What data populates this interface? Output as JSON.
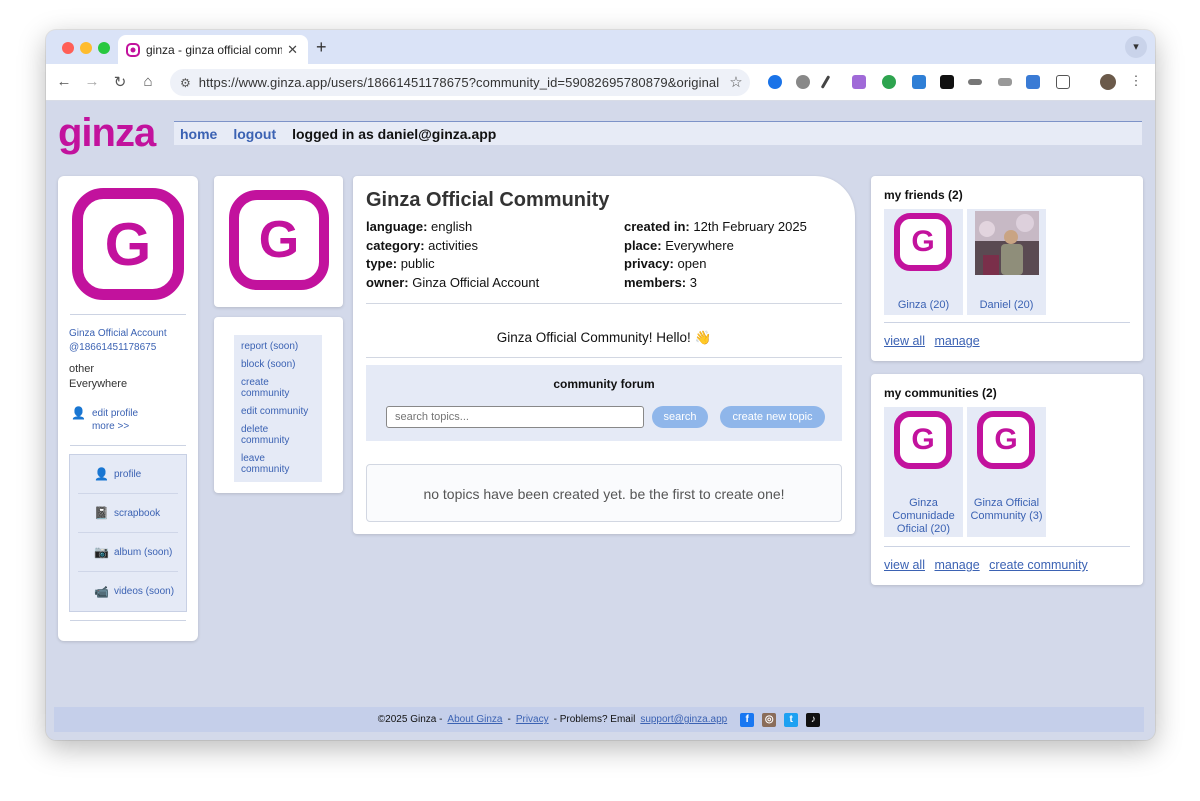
{
  "browser": {
    "tab_title": "ginza - ginza official community",
    "url": "https://www.ginza.app/users/18661451178675?community_id=59082695780879&original_pro...",
    "new_tab": "+",
    "close": "✕"
  },
  "header": {
    "logo": "ginza",
    "nav_home": "home",
    "nav_logout": "logout",
    "logged_in": "logged in as daniel@ginza.app"
  },
  "profile": {
    "name": "Ginza Official Account",
    "handle": "@18661451178675",
    "gender": "other",
    "location": "Everywhere",
    "edit_profile": "edit profile",
    "more": "more >>",
    "menu": [
      {
        "label": "profile",
        "icon": "person-icon"
      },
      {
        "label": "scrapbook",
        "icon": "notebook-icon"
      },
      {
        "label": "album (soon)",
        "icon": "camera-icon"
      },
      {
        "label": "videos (soon)",
        "icon": "video-icon"
      }
    ]
  },
  "actions": [
    "report (soon)",
    "block (soon)",
    "create community",
    "edit community",
    "delete community",
    "leave community"
  ],
  "community": {
    "title": "Ginza Official Community",
    "language_label": "language:",
    "language": "english",
    "category_label": "category:",
    "category": "activities",
    "type_label": "type:",
    "type": "public",
    "owner_label": "owner:",
    "owner": "Ginza Official Account",
    "created_label": "created in:",
    "created": "12th February 2025",
    "place_label": "place:",
    "place": "Everywhere",
    "privacy_label": "privacy:",
    "privacy": "open",
    "members_label": "members:",
    "members": "3",
    "message": "Ginza Official Community! Hello! 👋"
  },
  "forum": {
    "title": "community forum",
    "search_placeholder": "search topics...",
    "search_button": "search",
    "new_topic_button": "create new topic",
    "empty_message": "no topics have been created yet. be the first to create one!"
  },
  "friends": {
    "heading": "my friends (2)",
    "items": [
      {
        "label": "Ginza (20)"
      },
      {
        "label": "Daniel (20)"
      }
    ],
    "view_all": "view all",
    "manage": "manage"
  },
  "communities": {
    "heading": "my communities (2)",
    "items": [
      {
        "label": "Ginza Comunidade Oficial (20)"
      },
      {
        "label": "Ginza Official Community (3)"
      }
    ],
    "view_all": "view all",
    "manage": "manage",
    "create": "create community"
  },
  "footer": {
    "copyright": "©2025 Ginza -",
    "about": "About Ginza",
    "sep": "-",
    "privacy": "Privacy",
    "problems": "- Problems? Email",
    "email": "support@ginza.app"
  },
  "colors": {
    "brand": "#c2129d",
    "link": "#3b62b3",
    "page_bg": "#d3d9ea"
  }
}
